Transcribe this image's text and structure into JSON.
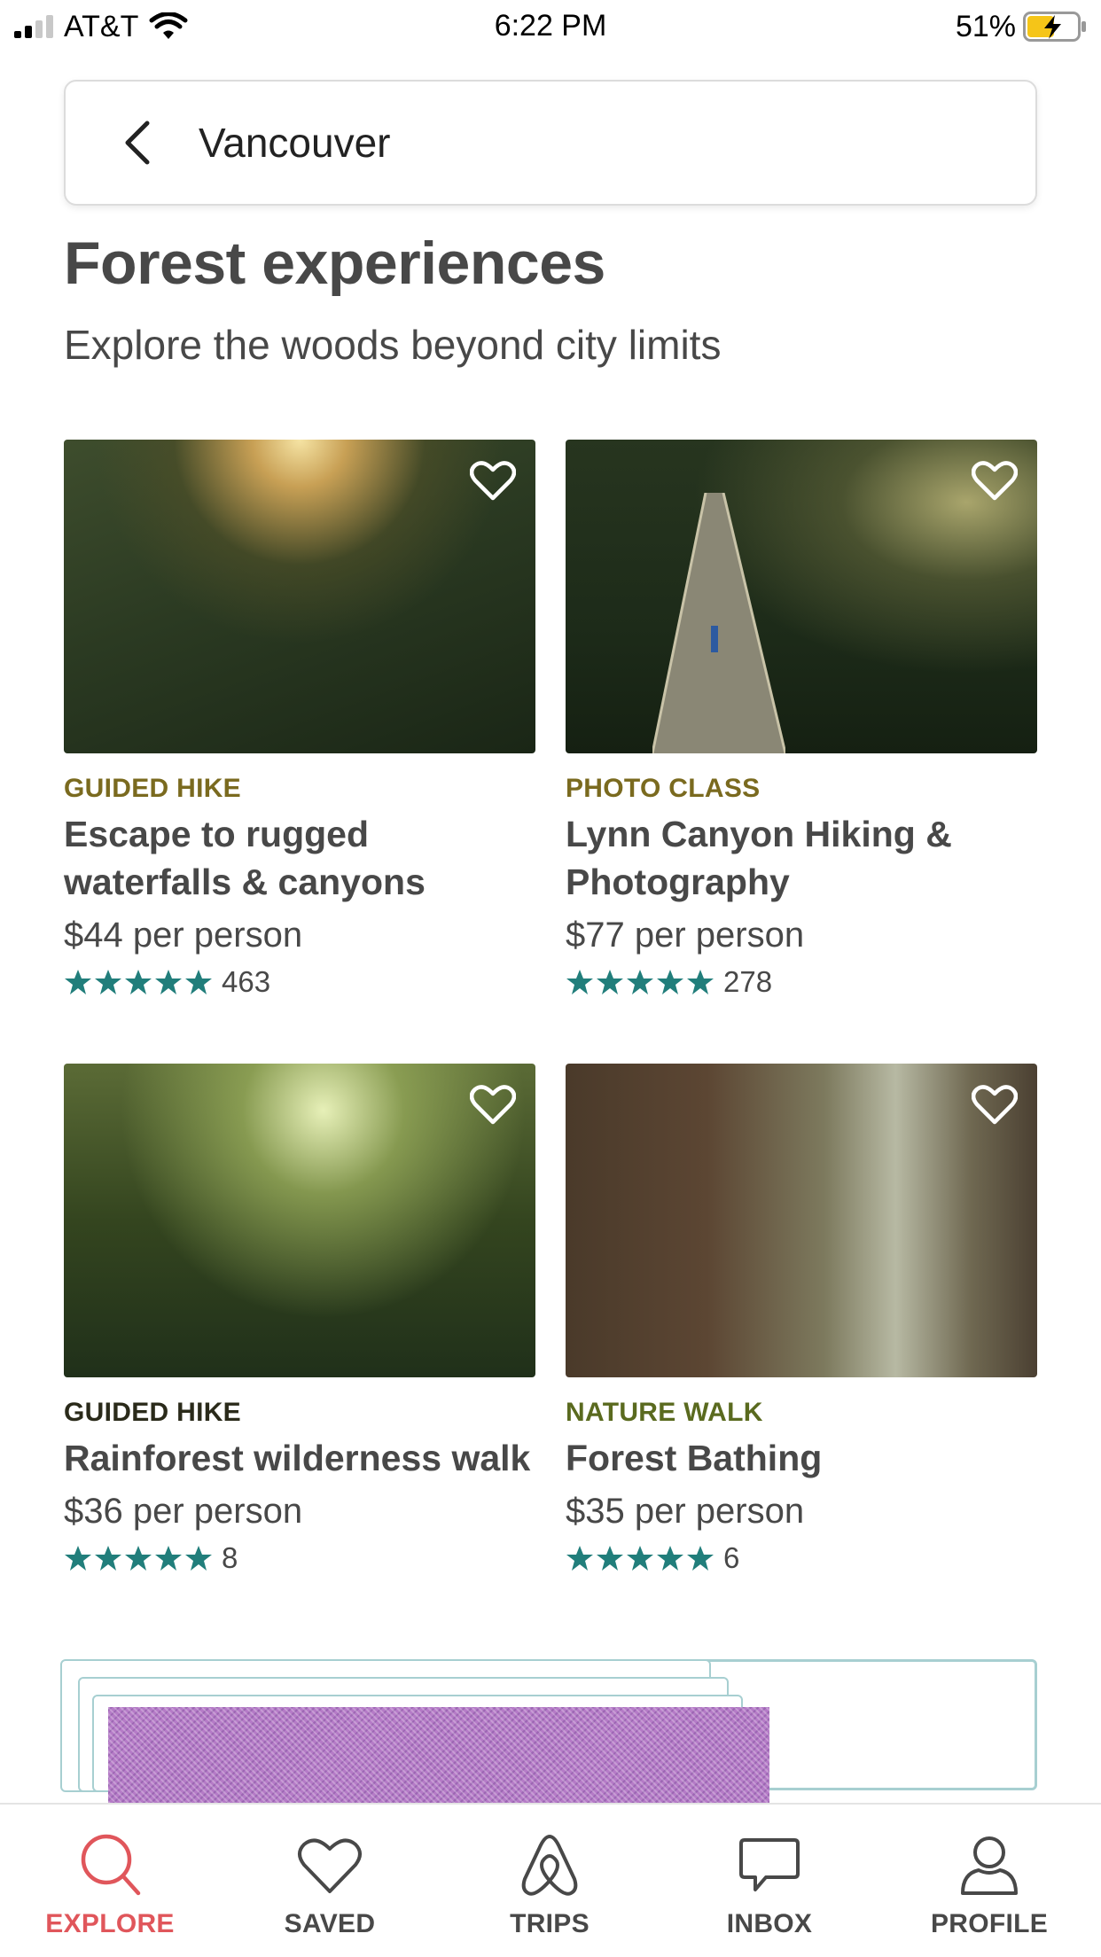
{
  "status_bar": {
    "carrier": "AT&T",
    "time": "6:22 PM",
    "battery": "51%"
  },
  "search": {
    "query": "Vancouver"
  },
  "section": {
    "title": "Forest experiences",
    "subtitle": "Explore the woods beyond city limits"
  },
  "cards": [
    {
      "category": "GUIDED HIKE",
      "category_color": "#7a6a1f",
      "title_line1": "Escape to rugged",
      "title_line2": "waterfalls & canyons",
      "price": "$44 per person",
      "rating": 5,
      "reviews": "463"
    },
    {
      "category": "PHOTO CLASS",
      "category_color": "#7a6a1f",
      "title_line1": "Lynn Canyon Hiking &",
      "title_line2": "Photography",
      "price": "$77 per person",
      "rating": 5,
      "reviews": "278"
    },
    {
      "category": "GUIDED HIKE",
      "category_color": "#2a2a1a",
      "title_line1": "Rainforest wilderness walk",
      "title_line2": "",
      "price": "$36 per person",
      "rating": 5,
      "reviews": "8"
    },
    {
      "category": "NATURE WALK",
      "category_color": "#5a6a1f",
      "title_line1": "Forest Bathing",
      "title_line2": "",
      "price": "$35 per person",
      "rating": 5,
      "reviews": "6"
    }
  ],
  "tabs": [
    {
      "label": "EXPLORE",
      "icon": "search-icon",
      "active": true
    },
    {
      "label": "SAVED",
      "icon": "heart-icon",
      "active": false
    },
    {
      "label": "TRIPS",
      "icon": "airbnb-logo-icon",
      "active": false
    },
    {
      "label": "INBOX",
      "icon": "chat-bubble-icon",
      "active": false
    },
    {
      "label": "PROFILE",
      "icon": "person-icon",
      "active": false
    }
  ],
  "colors": {
    "accent": "#e0565b",
    "star": "#217e7b",
    "text": "#484848",
    "tab_inactive": "#484848"
  }
}
